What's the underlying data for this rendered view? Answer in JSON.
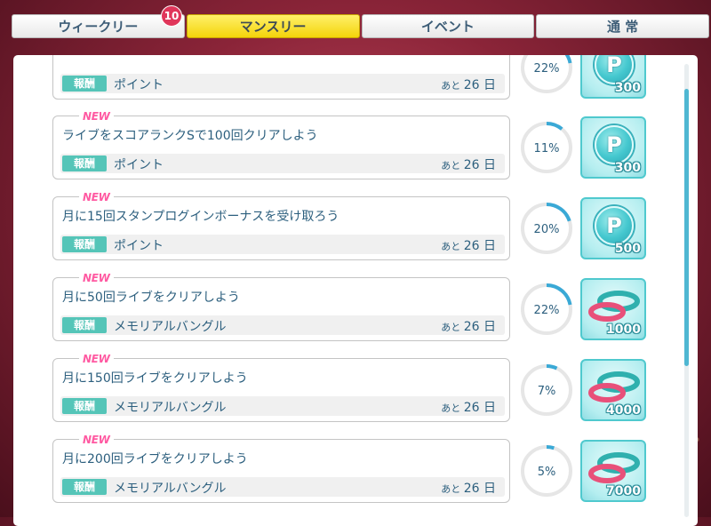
{
  "tabs": [
    {
      "label": "ウィークリー",
      "active": false
    },
    {
      "label": "マンスリー",
      "active": true
    },
    {
      "label": "イベント",
      "active": false
    },
    {
      "label": "通 常",
      "active": false
    }
  ],
  "tab_badge": "10",
  "reward_label": "報酬",
  "new_label": "NEW",
  "remaining_prefix": "あと",
  "remaining_suffix": "日",
  "missions": [
    {
      "title": "",
      "reward": "ポイント",
      "days": "26",
      "progress_text": "22%",
      "progress": 0.22,
      "icon": "point-coin",
      "count": "300",
      "new": false
    },
    {
      "title": "ライブをスコアランクSで100回クリアしよう",
      "reward": "ポイント",
      "days": "26",
      "progress_text": "11%",
      "progress": 0.11,
      "icon": "point-coin",
      "count": "300",
      "new": true
    },
    {
      "title": "月に15回スタンプログインボーナスを受け取ろう",
      "reward": "ポイント",
      "days": "26",
      "progress_text": "20%",
      "progress": 0.2,
      "icon": "point-coin",
      "count": "500",
      "new": true
    },
    {
      "title": "月に50回ライブをクリアしよう",
      "reward": "メモリアルバングル",
      "days": "26",
      "progress_text": "22%",
      "progress": 0.22,
      "icon": "bangle",
      "count": "1000",
      "new": true
    },
    {
      "title": "月に150回ライブをクリアしよう",
      "reward": "メモリアルバングル",
      "days": "26",
      "progress_text": "7%",
      "progress": 0.07,
      "icon": "bangle",
      "count": "4000",
      "new": true
    },
    {
      "title": "月に200回ライブをクリアしよう",
      "reward": "メモリアルバングル",
      "days": "26",
      "progress_text": "5%",
      "progress": 0.05,
      "icon": "bangle",
      "count": "7000",
      "new": true
    }
  ],
  "coin_letter": "P",
  "colors": {
    "accent": "#4fc9ce",
    "progress": "#3aa9d6",
    "new": "#ff5aa2",
    "tab_active": "#f4d40a"
  }
}
